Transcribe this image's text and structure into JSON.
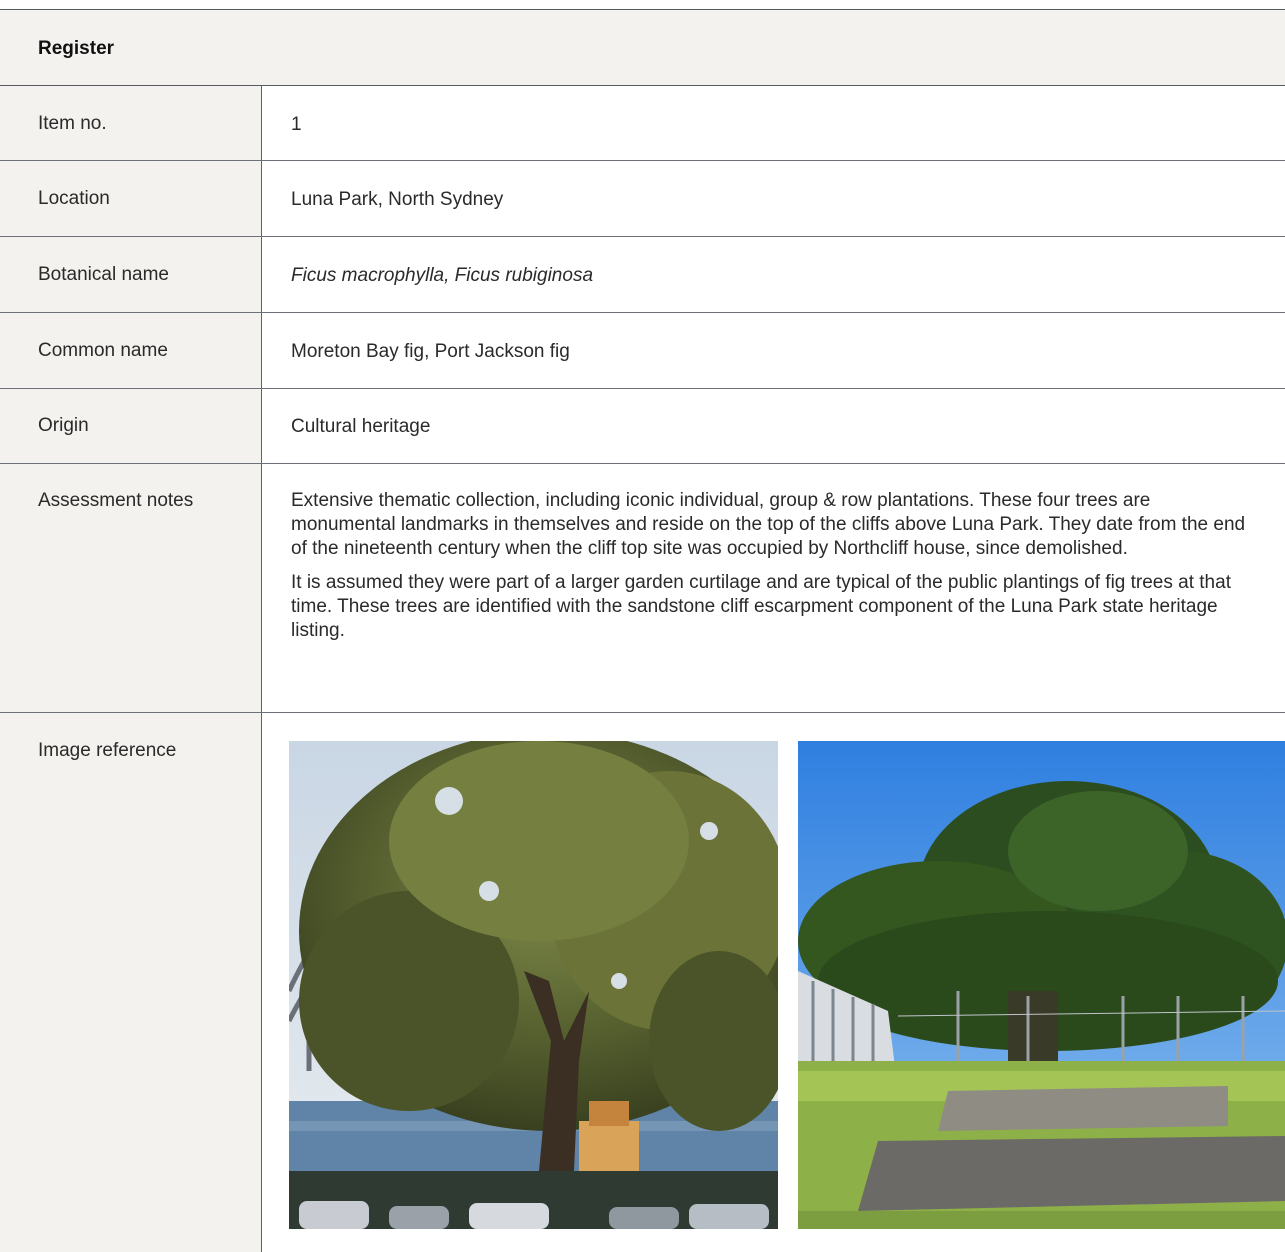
{
  "header": {
    "title": "Register"
  },
  "rows": {
    "item_no": {
      "label": "Item no.",
      "value": "1"
    },
    "location": {
      "label": "Location",
      "value": "Luna Park, North Sydney"
    },
    "botanical_name": {
      "label": "Botanical name",
      "value": "Ficus macrophylla, Ficus rubiginosa"
    },
    "common_name": {
      "label": "Common name",
      "value": "Moreton Bay fig, Port Jackson fig"
    },
    "origin": {
      "label": "Origin",
      "value": "Cultural heritage"
    },
    "assessment_notes": {
      "label": "Assessment notes",
      "paragraphs": [
        "Extensive thematic collection, including iconic individual, group & row plantations. These four trees are monumental landmarks in themselves and reside on the top of the cliffs above Luna Park. They date from the end of the nineteenth century when the cliff top site was occupied by Northcliff house, since demolished.",
        "It is assumed they were part of a larger garden curtilage and are typical of the public plantings of fig trees at that time. These trees are identified with the sandstone cliff escarpment component of the Luna Park state heritage listing."
      ]
    },
    "image_reference": {
      "label": "Image reference"
    }
  },
  "colors": {
    "label_background": "#f4f2ee",
    "rule": "#6c7177"
  }
}
